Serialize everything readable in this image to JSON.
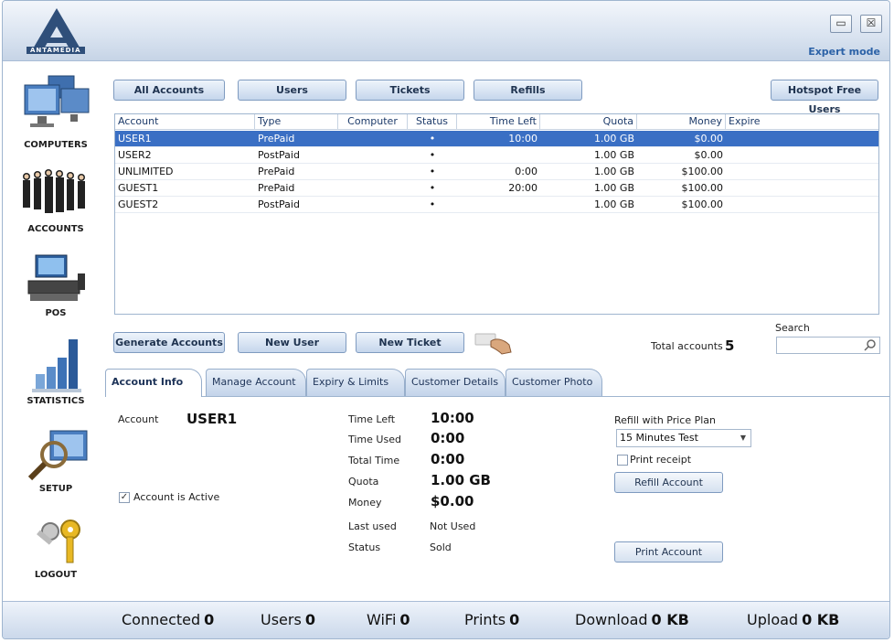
{
  "brand": {
    "name": "ANTAMEDIA"
  },
  "window": {
    "minimize": "▭",
    "close": "☒",
    "expert_mode": "Expert mode"
  },
  "sidebar": {
    "items": [
      {
        "label": "COMPUTERS",
        "icon": "computers-icon"
      },
      {
        "label": "ACCOUNTS",
        "icon": "accounts-icon"
      },
      {
        "label": "POS",
        "icon": "pos-icon"
      },
      {
        "label": "STATISTICS",
        "icon": "statistics-icon"
      },
      {
        "label": "SETUP",
        "icon": "setup-icon"
      },
      {
        "label": "LOGOUT",
        "icon": "logout-icon"
      }
    ]
  },
  "toolbar": {
    "all_accounts": "All Accounts",
    "users": "Users",
    "tickets": "Tickets",
    "refills": "Refills",
    "hotspot_free_users": "Hotspot Free Users"
  },
  "table": {
    "headers": [
      "Account",
      "Type",
      "Computer",
      "Status",
      "Time Left",
      "Quota",
      "Money",
      "Expire"
    ],
    "rows": [
      {
        "account": "USER1",
        "type": "PrePaid",
        "computer": "",
        "status": "•",
        "time_left": "10:00",
        "quota": "1.00 GB",
        "money": "$0.00",
        "expire": ""
      },
      {
        "account": "USER2",
        "type": "PostPaid",
        "computer": "",
        "status": "•",
        "time_left": "",
        "quota": "1.00 GB",
        "money": "$0.00",
        "expire": ""
      },
      {
        "account": "UNLIMITED",
        "type": "PrePaid",
        "computer": "",
        "status": "•",
        "time_left": "0:00",
        "quota": "1.00 GB",
        "money": "$100.00",
        "expire": ""
      },
      {
        "account": "GUEST1",
        "type": "PrePaid",
        "computer": "",
        "status": "•",
        "time_left": "20:00",
        "quota": "1.00 GB",
        "money": "$100.00",
        "expire": ""
      },
      {
        "account": "GUEST2",
        "type": "PostPaid",
        "computer": "",
        "status": "•",
        "time_left": "",
        "quota": "1.00 GB",
        "money": "$100.00",
        "expire": ""
      }
    ],
    "selected_index": 0
  },
  "actions": {
    "generate_accounts": "Generate Accounts",
    "new_user": "New User",
    "new_ticket": "New Ticket",
    "total_accounts_label": "Total accounts",
    "total_accounts_value": "5",
    "search_label": "Search",
    "search_value": ""
  },
  "tabs": [
    "Account Info",
    "Manage Account",
    "Expiry & Limits",
    "Customer Details",
    "Customer Photo"
  ],
  "account_info": {
    "account_label": "Account",
    "account_value": "USER1",
    "active_label": "Account is Active",
    "active_checked": true,
    "time_left_label": "Time Left",
    "time_left_value": "10:00",
    "time_used_label": "Time Used",
    "time_used_value": "0:00",
    "total_time_label": "Total Time",
    "total_time_value": "0:00",
    "quota_label": "Quota",
    "quota_value": "1.00 GB",
    "money_label": "Money",
    "money_value": "$0.00",
    "last_used_label": "Last used",
    "last_used_value": "Not Used",
    "status_label": "Status",
    "status_value": "Sold",
    "refill_label": "Refill with Price Plan",
    "refill_plan": "15 Minutes Test",
    "print_receipt_label": "Print receipt",
    "print_receipt_checked": false,
    "refill_button": "Refill Account",
    "print_button": "Print Account"
  },
  "statusbar": {
    "connected_label": "Connected",
    "connected_value": "0",
    "users_label": "Users",
    "users_value": "0",
    "wifi_label": "WiFi",
    "wifi_value": "0",
    "prints_label": "Prints",
    "prints_value": "0",
    "download_label": "Download",
    "download_value": "0 KB",
    "upload_label": "Upload",
    "upload_value": "0 KB"
  },
  "colors": {
    "accent": "#3a6fc4",
    "link": "#2c62a7",
    "button_top": "#eef4fb",
    "button_bottom": "#c5d6ec"
  }
}
